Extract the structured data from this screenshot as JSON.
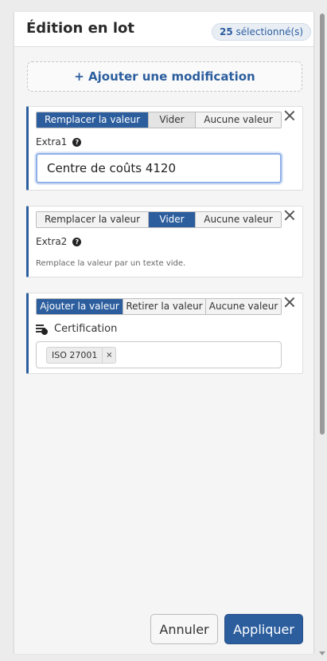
{
  "header": {
    "title": "Édition en lot",
    "selected_count": "25",
    "selected_suffix": "sélectionné(s)"
  },
  "add_modification_label": "+ Ajouter une modification",
  "cards": [
    {
      "options": [
        "Remplacer la valeur",
        "Vider",
        "Aucune valeur"
      ],
      "field": "Extra1",
      "input_value": "Centre de coûts 4120"
    },
    {
      "options": [
        "Remplacer la valeur",
        "Vider",
        "Aucune valeur"
      ],
      "field": "Extra2",
      "note": "Remplace la valeur par un texte vide."
    },
    {
      "options": [
        "Ajouter la valeur",
        "Retirer la valeur",
        "Aucune valeur"
      ],
      "field": "Certification",
      "tags": [
        {
          "label": "ISO 27001",
          "remove": "×"
        }
      ]
    }
  ],
  "footer": {
    "cancel_label": "Annuler",
    "apply_label": "Appliquer"
  },
  "colors": {
    "accent": "#2c5e9e",
    "active_option_text": "#ffffff",
    "focus_ring": "#8fb0e6"
  },
  "icons": [
    "help-icon",
    "close-icon",
    "list-icon",
    "remove-tag-icon"
  ]
}
